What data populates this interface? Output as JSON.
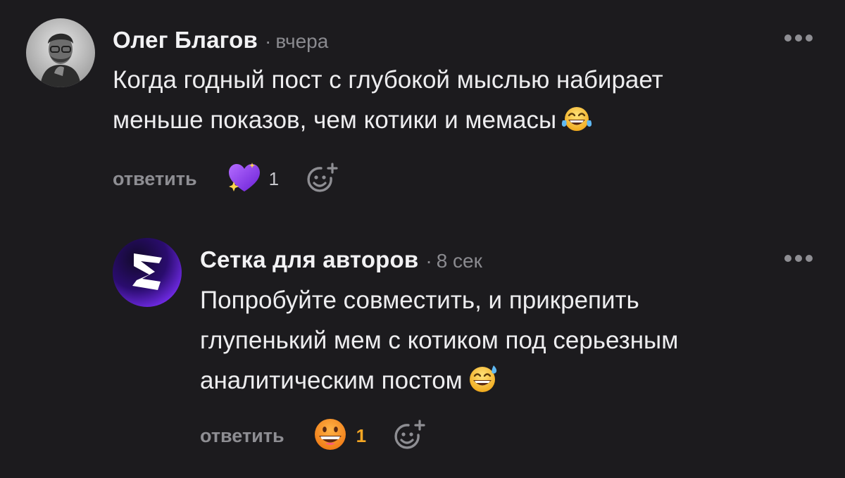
{
  "comments": [
    {
      "author": "Олег Благов",
      "separator": "·",
      "time": "вчера",
      "text_lines": [
        "Когда годный пост с глубокой мыслью набирает",
        "меньше показов, чем котики и мемасы"
      ],
      "inline_emoji": "face-with-tears-of-joy-emoji",
      "reply_label": "ответить",
      "reaction": {
        "icon": "purple-sparkling-heart-icon",
        "count": "1",
        "count_color": "#c7c7cc"
      },
      "add_reaction_icon": "add-reaction-smiley-icon",
      "more_icon": "more-dots-icon"
    },
    {
      "author": "Сетка для авторов",
      "separator": "·",
      "time": "8 сек",
      "text_lines": [
        "Попробуйте совместить, и прикрепить",
        "глупенький мем с котиком под серьезным",
        "аналитическим постом"
      ],
      "inline_emoji": "grinning-face-with-sweat-emoji",
      "reply_label": "ответить",
      "reaction": {
        "icon": "grinning-face-emoji",
        "count": "1",
        "count_color": "#f5a623"
      },
      "add_reaction_icon": "add-reaction-smiley-icon",
      "more_icon": "more-dots-icon"
    }
  ],
  "colors": {
    "background": "#1c1b1e",
    "text": "#ededef",
    "muted": "#8e8e93",
    "accent_purple": "#7b2ff7",
    "accent_orange": "#f5a623"
  }
}
